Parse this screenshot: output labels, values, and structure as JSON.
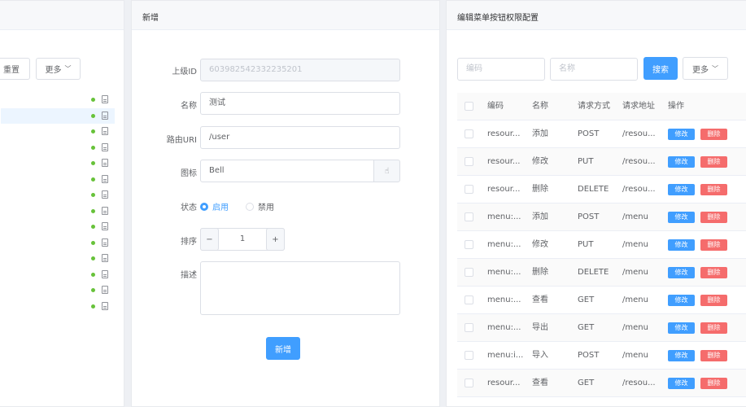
{
  "left_panel": {
    "reset_label": "重置",
    "more_label": "更多",
    "tree_count": 14,
    "selected_index": 1
  },
  "form_panel": {
    "title": "新增",
    "fields": {
      "parent_id": {
        "label": "上级ID",
        "value": "603982542332235201"
      },
      "name": {
        "label": "名称",
        "value": "测试"
      },
      "route": {
        "label": "路由URI",
        "value": "/user"
      },
      "icon": {
        "label": "图标",
        "value": "Bell"
      },
      "status": {
        "label": "状态",
        "options": [
          "启用",
          "禁用"
        ],
        "selected": "启用"
      },
      "sort": {
        "label": "排序",
        "value": "1",
        "minus": "−",
        "plus": "+"
      },
      "desc": {
        "label": "描述",
        "value": ""
      }
    },
    "submit_label": "新增"
  },
  "right_panel": {
    "title": "编辑菜单按钮权限配置",
    "code_placeholder": "编码",
    "name_placeholder": "名称",
    "search_label": "搜索",
    "more_label": "更多",
    "columns": [
      "编码",
      "名称",
      "请求方式",
      "请求地址",
      "操作"
    ],
    "edit_label": "修改",
    "delete_label": "删除",
    "rows": [
      {
        "code": "resour...",
        "name": "添加",
        "method": "POST",
        "url": "/resou..."
      },
      {
        "code": "resour...",
        "name": "修改",
        "method": "PUT",
        "url": "/resou..."
      },
      {
        "code": "resour...",
        "name": "删除",
        "method": "DELETE",
        "url": "/resou..."
      },
      {
        "code": "menu:...",
        "name": "添加",
        "method": "POST",
        "url": "/menu"
      },
      {
        "code": "menu:...",
        "name": "修改",
        "method": "PUT",
        "url": "/menu"
      },
      {
        "code": "menu:...",
        "name": "删除",
        "method": "DELETE",
        "url": "/menu"
      },
      {
        "code": "menu:...",
        "name": "查看",
        "method": "GET",
        "url": "/menu"
      },
      {
        "code": "menu:...",
        "name": "导出",
        "method": "GET",
        "url": "/menu"
      },
      {
        "code": "menu:i...",
        "name": "导入",
        "method": "POST",
        "url": "/menu"
      },
      {
        "code": "resour...",
        "name": "查看",
        "method": "GET",
        "url": "/resou..."
      }
    ]
  },
  "colors": {
    "primary": "#409eff",
    "danger": "#f56c6c",
    "success": "#67c23a"
  }
}
